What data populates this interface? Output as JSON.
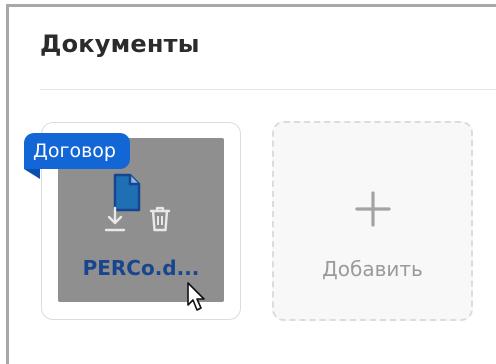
{
  "section": {
    "title": "Документы"
  },
  "document_card": {
    "tag_label": "Договор",
    "file_name": "PERCo.d...",
    "icons": {
      "file": "file-icon",
      "download": "download-icon",
      "delete": "trash-icon"
    }
  },
  "add_card": {
    "label": "Добавить",
    "icon": "plus-icon"
  },
  "colors": {
    "accent": "#1266d6",
    "file_name": "#17458f",
    "overlay": "#8f8f8f",
    "muted": "#9a9a9a"
  }
}
